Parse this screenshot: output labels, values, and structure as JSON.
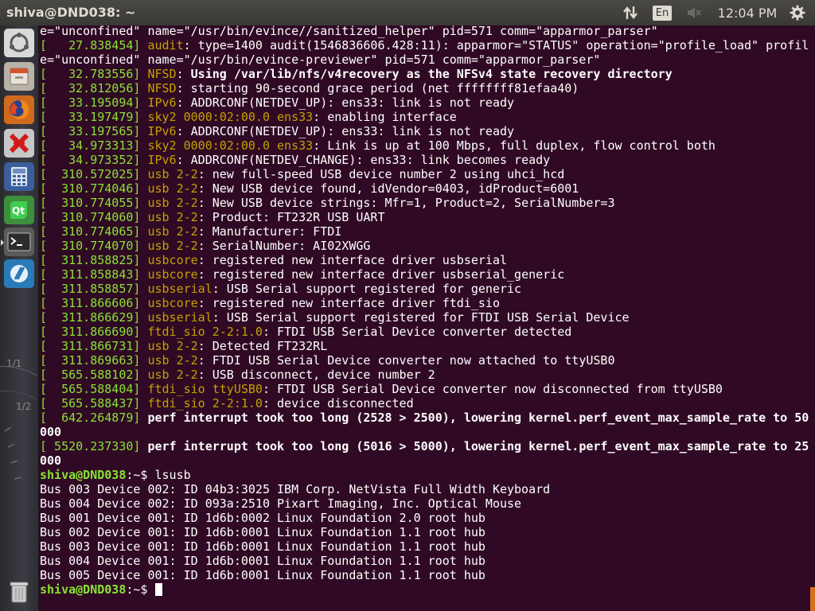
{
  "window_title": "shiva@DND038: ~",
  "top_panel": {
    "keyboard_layout": "En",
    "clock": "12:04 PM",
    "icons": [
      "network-arrows-icon",
      "keyboard-layout-icon",
      "volume-muted-icon",
      "settings-gear-icon"
    ]
  },
  "launcher": {
    "items": [
      "ubuntu-dash-icon",
      "files-icon",
      "firefox-icon",
      "xmind-icon",
      "calculator-icon",
      "qt-creator-icon",
      "terminal-icon",
      "arduino-icon",
      "trash-icon"
    ],
    "background_labels": [
      "1/1",
      "1/2"
    ]
  },
  "terminal": {
    "lines": [
      {
        "parts": [
          {
            "t": "e=\"unconfined\" name=\"/usr/bin/evince//sanitized_helper\" pid=571 comm=\"apparmor_parser\""
          }
        ]
      },
      {
        "parts": [
          {
            "t": "[   27.838454] ",
            "c": "ts"
          },
          {
            "t": "audit",
            "c": "mod"
          },
          {
            "t": ": type=1400 audit(1546836606.428:11): apparmor=\"STATUS\" operation=\"profile_load\" profil"
          }
        ]
      },
      {
        "parts": [
          {
            "t": "e=\"unconfined\" name=\"/usr/bin/evince-previewer\" pid=571 comm=\"apparmor_parser\""
          }
        ]
      },
      {
        "parts": [
          {
            "t": "[   32.783556] ",
            "c": "ts"
          },
          {
            "t": "NFSD",
            "c": "mod"
          },
          {
            "t": ": "
          },
          {
            "t": "Using /var/lib/nfs/v4recovery as the NFSv4 state recovery directory",
            "c": "b"
          }
        ]
      },
      {
        "parts": [
          {
            "t": "[   32.812056] ",
            "c": "ts"
          },
          {
            "t": "NFSD",
            "c": "mod"
          },
          {
            "t": ": starting 90-second grace period (net ffffffff81efaa40)"
          }
        ]
      },
      {
        "parts": [
          {
            "t": "[   33.195094] ",
            "c": "ts"
          },
          {
            "t": "IPv6",
            "c": "mod"
          },
          {
            "t": ": ADDRCONF(NETDEV_UP): ens33: link is not ready"
          }
        ]
      },
      {
        "parts": [
          {
            "t": "[   33.197479] ",
            "c": "ts"
          },
          {
            "t": "sky2 0000:02:00.0 ens33",
            "c": "mod"
          },
          {
            "t": ": enabling interface"
          }
        ]
      },
      {
        "parts": [
          {
            "t": "[   33.197565] ",
            "c": "ts"
          },
          {
            "t": "IPv6",
            "c": "mod"
          },
          {
            "t": ": ADDRCONF(NETDEV_UP): ens33: link is not ready"
          }
        ]
      },
      {
        "parts": [
          {
            "t": "[   34.973313] ",
            "c": "ts"
          },
          {
            "t": "sky2 0000:02:00.0 ens33",
            "c": "mod"
          },
          {
            "t": ": Link is up at 100 Mbps, full duplex, flow control both"
          }
        ]
      },
      {
        "parts": [
          {
            "t": "[   34.973352] ",
            "c": "ts"
          },
          {
            "t": "IPv6",
            "c": "mod"
          },
          {
            "t": ": ADDRCONF(NETDEV_CHANGE): ens33: link becomes ready"
          }
        ]
      },
      {
        "parts": [
          {
            "t": "[  310.572025] ",
            "c": "ts"
          },
          {
            "t": "usb 2-2",
            "c": "mod"
          },
          {
            "t": ": new full-speed USB device number 2 using uhci_hcd"
          }
        ]
      },
      {
        "parts": [
          {
            "t": "[  310.774046] ",
            "c": "ts"
          },
          {
            "t": "usb 2-2",
            "c": "mod"
          },
          {
            "t": ": New USB device found, idVendor=0403, idProduct=6001"
          }
        ]
      },
      {
        "parts": [
          {
            "t": "[  310.774055] ",
            "c": "ts"
          },
          {
            "t": "usb 2-2",
            "c": "mod"
          },
          {
            "t": ": New USB device strings: Mfr=1, Product=2, SerialNumber=3"
          }
        ]
      },
      {
        "parts": [
          {
            "t": "[  310.774060] ",
            "c": "ts"
          },
          {
            "t": "usb 2-2",
            "c": "mod"
          },
          {
            "t": ": Product: FT232R USB UART"
          }
        ]
      },
      {
        "parts": [
          {
            "t": "[  310.774065] ",
            "c": "ts"
          },
          {
            "t": "usb 2-2",
            "c": "mod"
          },
          {
            "t": ": Manufacturer: FTDI"
          }
        ]
      },
      {
        "parts": [
          {
            "t": "[  310.774070] ",
            "c": "ts"
          },
          {
            "t": "usb 2-2",
            "c": "mod"
          },
          {
            "t": ": SerialNumber: AI02XWGG"
          }
        ]
      },
      {
        "parts": [
          {
            "t": "[  311.858825] ",
            "c": "ts"
          },
          {
            "t": "usbcore",
            "c": "mod"
          },
          {
            "t": ": registered new interface driver usbserial"
          }
        ]
      },
      {
        "parts": [
          {
            "t": "[  311.858843] ",
            "c": "ts"
          },
          {
            "t": "usbcore",
            "c": "mod"
          },
          {
            "t": ": registered new interface driver usbserial_generic"
          }
        ]
      },
      {
        "parts": [
          {
            "t": "[  311.858857] ",
            "c": "ts"
          },
          {
            "t": "usbserial",
            "c": "mod"
          },
          {
            "t": ": USB Serial support registered for generic"
          }
        ]
      },
      {
        "parts": [
          {
            "t": "[  311.866606] ",
            "c": "ts"
          },
          {
            "t": "usbcore",
            "c": "mod"
          },
          {
            "t": ": registered new interface driver ftdi_sio"
          }
        ]
      },
      {
        "parts": [
          {
            "t": "[  311.866629] ",
            "c": "ts"
          },
          {
            "t": "usbserial",
            "c": "mod"
          },
          {
            "t": ": USB Serial support registered for FTDI USB Serial Device"
          }
        ]
      },
      {
        "parts": [
          {
            "t": "[  311.866690] ",
            "c": "ts"
          },
          {
            "t": "ftdi_sio 2-2:1.0",
            "c": "mod"
          },
          {
            "t": ": FTDI USB Serial Device converter detected"
          }
        ]
      },
      {
        "parts": [
          {
            "t": "[  311.866731] ",
            "c": "ts"
          },
          {
            "t": "usb 2-2",
            "c": "mod"
          },
          {
            "t": ": Detected FT232RL"
          }
        ]
      },
      {
        "parts": [
          {
            "t": "[  311.869663] ",
            "c": "ts"
          },
          {
            "t": "usb 2-2",
            "c": "mod"
          },
          {
            "t": ": FTDI USB Serial Device converter now attached to ttyUSB0"
          }
        ]
      },
      {
        "parts": [
          {
            "t": "[  565.588102] ",
            "c": "ts"
          },
          {
            "t": "usb 2-2",
            "c": "mod"
          },
          {
            "t": ": USB disconnect, device number 2"
          }
        ]
      },
      {
        "parts": [
          {
            "t": "[  565.588404] ",
            "c": "ts"
          },
          {
            "t": "ftdi_sio ttyUSB0",
            "c": "mod"
          },
          {
            "t": ": FTDI USB Serial Device converter now disconnected from ttyUSB0"
          }
        ]
      },
      {
        "parts": [
          {
            "t": "[  565.588437] ",
            "c": "ts"
          },
          {
            "t": "ftdi_sio 2-2:1.0",
            "c": "mod"
          },
          {
            "t": ": device disconnected"
          }
        ]
      },
      {
        "parts": [
          {
            "t": "[  642.264879] ",
            "c": "ts"
          },
          {
            "t": "perf interrupt took too long (2528 > 2500), lowering kernel.perf_event_max_sample_rate to 50",
            "c": "b"
          }
        ]
      },
      {
        "parts": [
          {
            "t": "000",
            "c": "b"
          }
        ]
      },
      {
        "parts": [
          {
            "t": "[ 5520.237330] ",
            "c": "ts"
          },
          {
            "t": "perf interrupt took too long (5016 > 5000), lowering kernel.perf_event_max_sample_rate to 25",
            "c": "b"
          }
        ]
      },
      {
        "parts": [
          {
            "t": "000",
            "c": "b"
          }
        ]
      },
      {
        "parts": [
          {
            "t": "shiva@DND038",
            "c": "prompt"
          },
          {
            "t": ":~$ lsusb"
          }
        ]
      },
      {
        "parts": [
          {
            "t": "Bus 003 Device 002: ID 04b3:3025 IBM Corp. NetVista Full Width Keyboard"
          }
        ]
      },
      {
        "parts": [
          {
            "t": "Bus 004 Device 002: ID 093a:2510 Pixart Imaging, Inc. Optical Mouse"
          }
        ]
      },
      {
        "parts": [
          {
            "t": "Bus 001 Device 001: ID 1d6b:0002 Linux Foundation 2.0 root hub"
          }
        ]
      },
      {
        "parts": [
          {
            "t": "Bus 002 Device 001: ID 1d6b:0001 Linux Foundation 1.1 root hub"
          }
        ]
      },
      {
        "parts": [
          {
            "t": "Bus 003 Device 001: ID 1d6b:0001 Linux Foundation 1.1 root hub"
          }
        ]
      },
      {
        "parts": [
          {
            "t": "Bus 004 Device 001: ID 1d6b:0001 Linux Foundation 1.1 root hub"
          }
        ]
      },
      {
        "parts": [
          {
            "t": "Bus 005 Device 001: ID 1d6b:0001 Linux Foundation 1.1 root hub"
          }
        ]
      },
      {
        "parts": [
          {
            "t": "shiva@DND038",
            "c": "prompt"
          },
          {
            "t": ":~$ "
          }
        ],
        "cursor": true
      }
    ],
    "colors": {
      "background": "#300a24",
      "timestamp": "#8ae234",
      "subsystem": "#c4a000",
      "text": "#ffffff",
      "prompt": "#8ae234"
    }
  }
}
